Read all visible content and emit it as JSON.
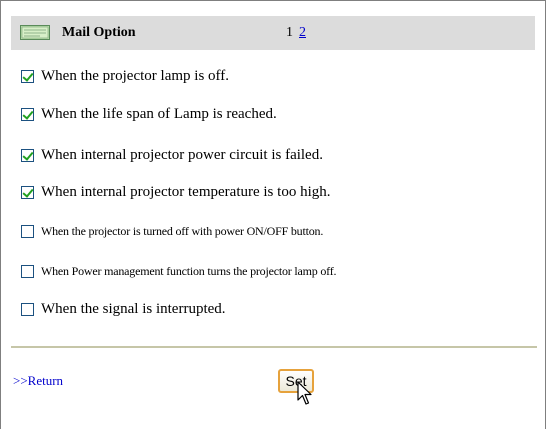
{
  "header": {
    "title": "Mail Option",
    "icon": "mail-envelope-icon",
    "pages": {
      "current": "1",
      "other": "2"
    }
  },
  "options": [
    {
      "label": "When the projector lamp is off.",
      "checked": true
    },
    {
      "label": "When the life span of Lamp is reached.",
      "checked": true
    },
    {
      "label": "When internal projector power circuit is failed.",
      "checked": true
    },
    {
      "label": "When internal projector temperature is too high.",
      "checked": true
    },
    {
      "label": "When the projector is turned off with power ON/OFF button.",
      "checked": false
    },
    {
      "label": "When Power management function turns the projector lamp off.",
      "checked": false
    },
    {
      "label": "When the signal is interrupted.",
      "checked": false
    }
  ],
  "footer": {
    "return_label": ">>Return",
    "set_label": "Set"
  },
  "colors": {
    "header_bg": "#dcdcdc",
    "link": "#0000cc",
    "check": "#21a121",
    "button_border": "#e6a23c"
  }
}
